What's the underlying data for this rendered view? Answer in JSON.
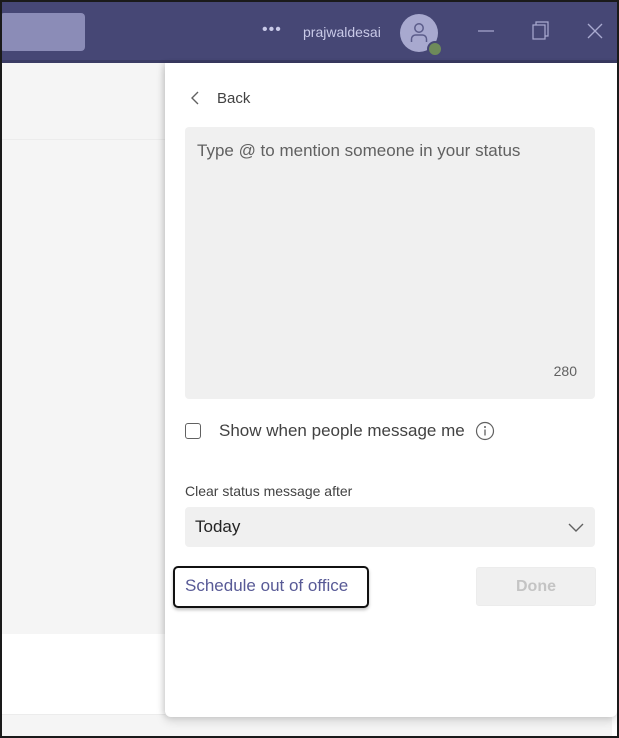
{
  "titlebar": {
    "more_label": "•••",
    "username": "prajwaldesai",
    "avatar_icon": "person-icon",
    "presence_color": "#6e8a5a",
    "window_controls": [
      "minimize",
      "maximize",
      "close"
    ]
  },
  "panel": {
    "back_label": "Back",
    "status_placeholder": "Type @ to mention someone in your status",
    "char_count": "280",
    "show_when_message_label": "Show when people message me",
    "show_when_message_checked": false,
    "clear_after_label": "Clear status message after",
    "clear_after_value": "Today",
    "schedule_ooo_label": "Schedule out of office",
    "done_label": "Done",
    "done_enabled": false
  },
  "colors": {
    "titlebar": "#464775",
    "link": "#585a96",
    "input_bg": "#f0f0f0"
  }
}
